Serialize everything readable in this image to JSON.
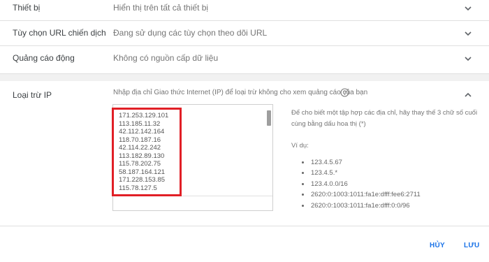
{
  "rows": [
    {
      "label": "Thiết bị",
      "value": "Hiển thị trên tất cả thiết bị"
    },
    {
      "label": "Tùy chọn URL chiến dịch",
      "value": "Đang sử dụng các tùy chọn theo dõi URL"
    },
    {
      "label": "Quảng cáo động",
      "value": "Không có nguồn cấp dữ liệu"
    }
  ],
  "ip_exclusion": {
    "label": "Loại trừ IP",
    "description": "Nhập địa chỉ Giao thức Internet (IP) để loại trừ không cho xem quảng cáo của bạn",
    "ips": [
      "171.253.129.101",
      "113.185.11.32",
      "42.112.142.164",
      "118.70.187.16",
      "42.114.22.242",
      "113.182.89.130",
      "115.78.202.75",
      "58.187.164.121",
      "171.228.153.85",
      "115.78.127.5"
    ],
    "help_text": "Để cho biết một tập hợp các địa chỉ, hãy thay thế 3 chữ số cuối cùng bằng dấu hoa thị (*)",
    "example_title": "Ví dụ:",
    "examples": [
      "123.4.5.67",
      "123.4.5.*",
      "123.4.0.0/16",
      "2620:0:1003:1011:fa1e:dfff:fee6:2711",
      "2620:0:1003:1011:fa1e:dfff:0:0/96"
    ]
  },
  "buttons": {
    "cancel": "HỦY",
    "save": "LƯU"
  },
  "colors": {
    "accent": "#1a73e8",
    "highlight": "#e11f26"
  }
}
